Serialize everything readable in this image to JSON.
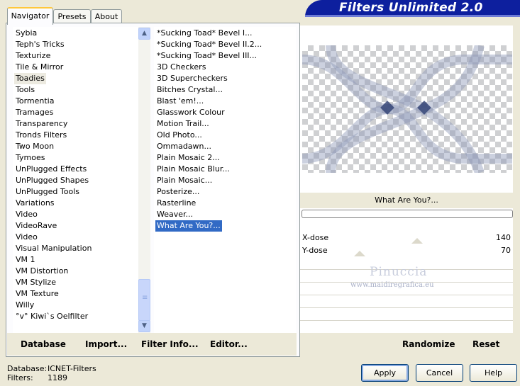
{
  "banner": {
    "title": "Filters Unlimited 2.0"
  },
  "tabs": [
    {
      "label": "Navigator",
      "active": true
    },
    {
      "label": "Presets",
      "active": false
    },
    {
      "label": "About",
      "active": false
    }
  ],
  "categories": [
    "Sybia",
    "Teph's Tricks",
    "Texturize",
    "Tile & Mirror",
    "Toadies",
    "Tools",
    "Tormentia",
    "Tramages",
    "Transparency",
    "Tronds Filters",
    "Two Moon",
    "Tymoes",
    "UnPlugged Effects",
    "UnPlugged Shapes",
    "UnPlugged Tools",
    "Variations",
    "Video",
    "VideoRave",
    "Video",
    "Visual Manipulation",
    "VM 1",
    "VM Distortion",
    "VM Stylize",
    "VM Texture",
    "Willy",
    "°v° Kiwi`s Oelfilter"
  ],
  "categories_selected": "Toadies",
  "filters": [
    "*Sucking Toad*  Bevel I...",
    "*Sucking Toad*  Bevel II.2...",
    "*Sucking Toad*  Bevel III...",
    "3D Checkers",
    "3D Supercheckers",
    "Bitches Crystal...",
    "Blast 'em!...",
    "Glasswork Colour",
    "Motion Trail...",
    "Old Photo...",
    "Ommadawn...",
    "Plain Mosaic 2...",
    "Plain Mosaic Blur...",
    "Plain Mosaic...",
    "Posterize...",
    "Rasterline",
    "Weaver...",
    "What Are You?..."
  ],
  "filters_selected": "What Are You?...",
  "left_buttons": {
    "database": "Database",
    "import": "Import...",
    "filter_info": "Filter Info...",
    "editor": "Editor..."
  },
  "preview": {
    "filter_name": "What Are You?...",
    "progress": 0
  },
  "params": [
    {
      "label": "X-dose",
      "value": "140"
    },
    {
      "label": "Y-dose",
      "value": "70"
    }
  ],
  "watermark": {
    "name": "Pinuccia",
    "url": "www.maidiregrafica.eu"
  },
  "right_buttons": {
    "randomize": "Randomize",
    "reset": "Reset"
  },
  "footer": {
    "database_label": "Database:",
    "database_value": "ICNET-Filters",
    "filters_label": "Filters:",
    "filters_value": "1189"
  },
  "dialog_buttons": {
    "apply": "Apply",
    "cancel": "Cancel",
    "help": "Help"
  },
  "colors": {
    "selection": "#316ac5",
    "banner": "#0d1f9e",
    "face": "#ece9d8"
  }
}
